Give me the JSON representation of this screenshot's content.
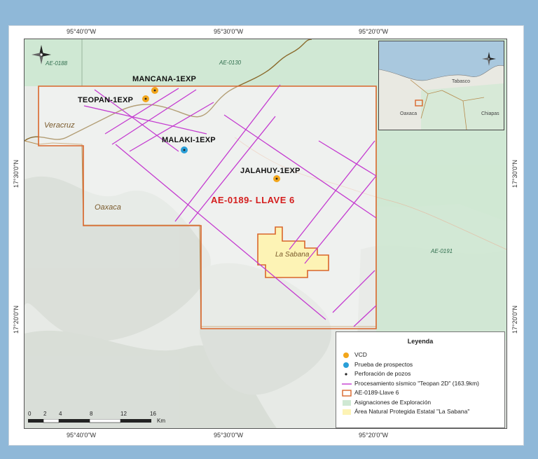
{
  "map": {
    "ticks_top": [
      "95°40'0\"W",
      "95°30'0\"W",
      "95°20'0\"W"
    ],
    "ticks_bottom": [
      "95°40'0\"W",
      "95°30'0\"W",
      "95°20'0\"W"
    ],
    "ticks_left": [
      "17°30'0\"N",
      "17°20'0\"N"
    ],
    "ticks_right": [
      "17°30'0\"N",
      "17°20'0\"N"
    ],
    "wells": [
      {
        "name": "MANCANA-1EXP",
        "type": "VCD"
      },
      {
        "name": "TEOPAN-1EXP",
        "type": "VCD"
      },
      {
        "name": "MALAKI-1EXP",
        "type": "Prueba de prospectos"
      },
      {
        "name": "JALAHUY-1EXP",
        "type": "VCD"
      }
    ],
    "states": [
      "Veracruz",
      "Oaxaca"
    ],
    "block_label": "AE-0189- LLAVE 6",
    "asignaciones": [
      "AE-0188",
      "AE-0130",
      "AE-0191"
    ],
    "anp_label": "La Sabana",
    "inset_labels": [
      "Oaxaca",
      "Tabasco",
      "Chiapas"
    ],
    "legend": {
      "title": "Leyenda",
      "items": [
        "VCD",
        "Prueba de prospectos",
        "Perforación de pozos",
        "Procesamiento sísmico \"Teopan 2D\" (163.9km)",
        "AE-0189-Llave 6",
        "Asignaciones de Exploración",
        "Área Natural Protegida Estatal \"La Sabana\""
      ]
    },
    "scale": {
      "labels": [
        "0",
        "2",
        "4",
        "8",
        "12",
        "16"
      ],
      "unit": "Km"
    },
    "colors": {
      "vcd": "#f2a61b",
      "prueba": "#2a9fd8",
      "seismic": "#c43bd0",
      "block_outline": "#d9662b",
      "asignacion_fill": "#cfe8d3",
      "anp_fill": "#fdf3b5"
    }
  }
}
